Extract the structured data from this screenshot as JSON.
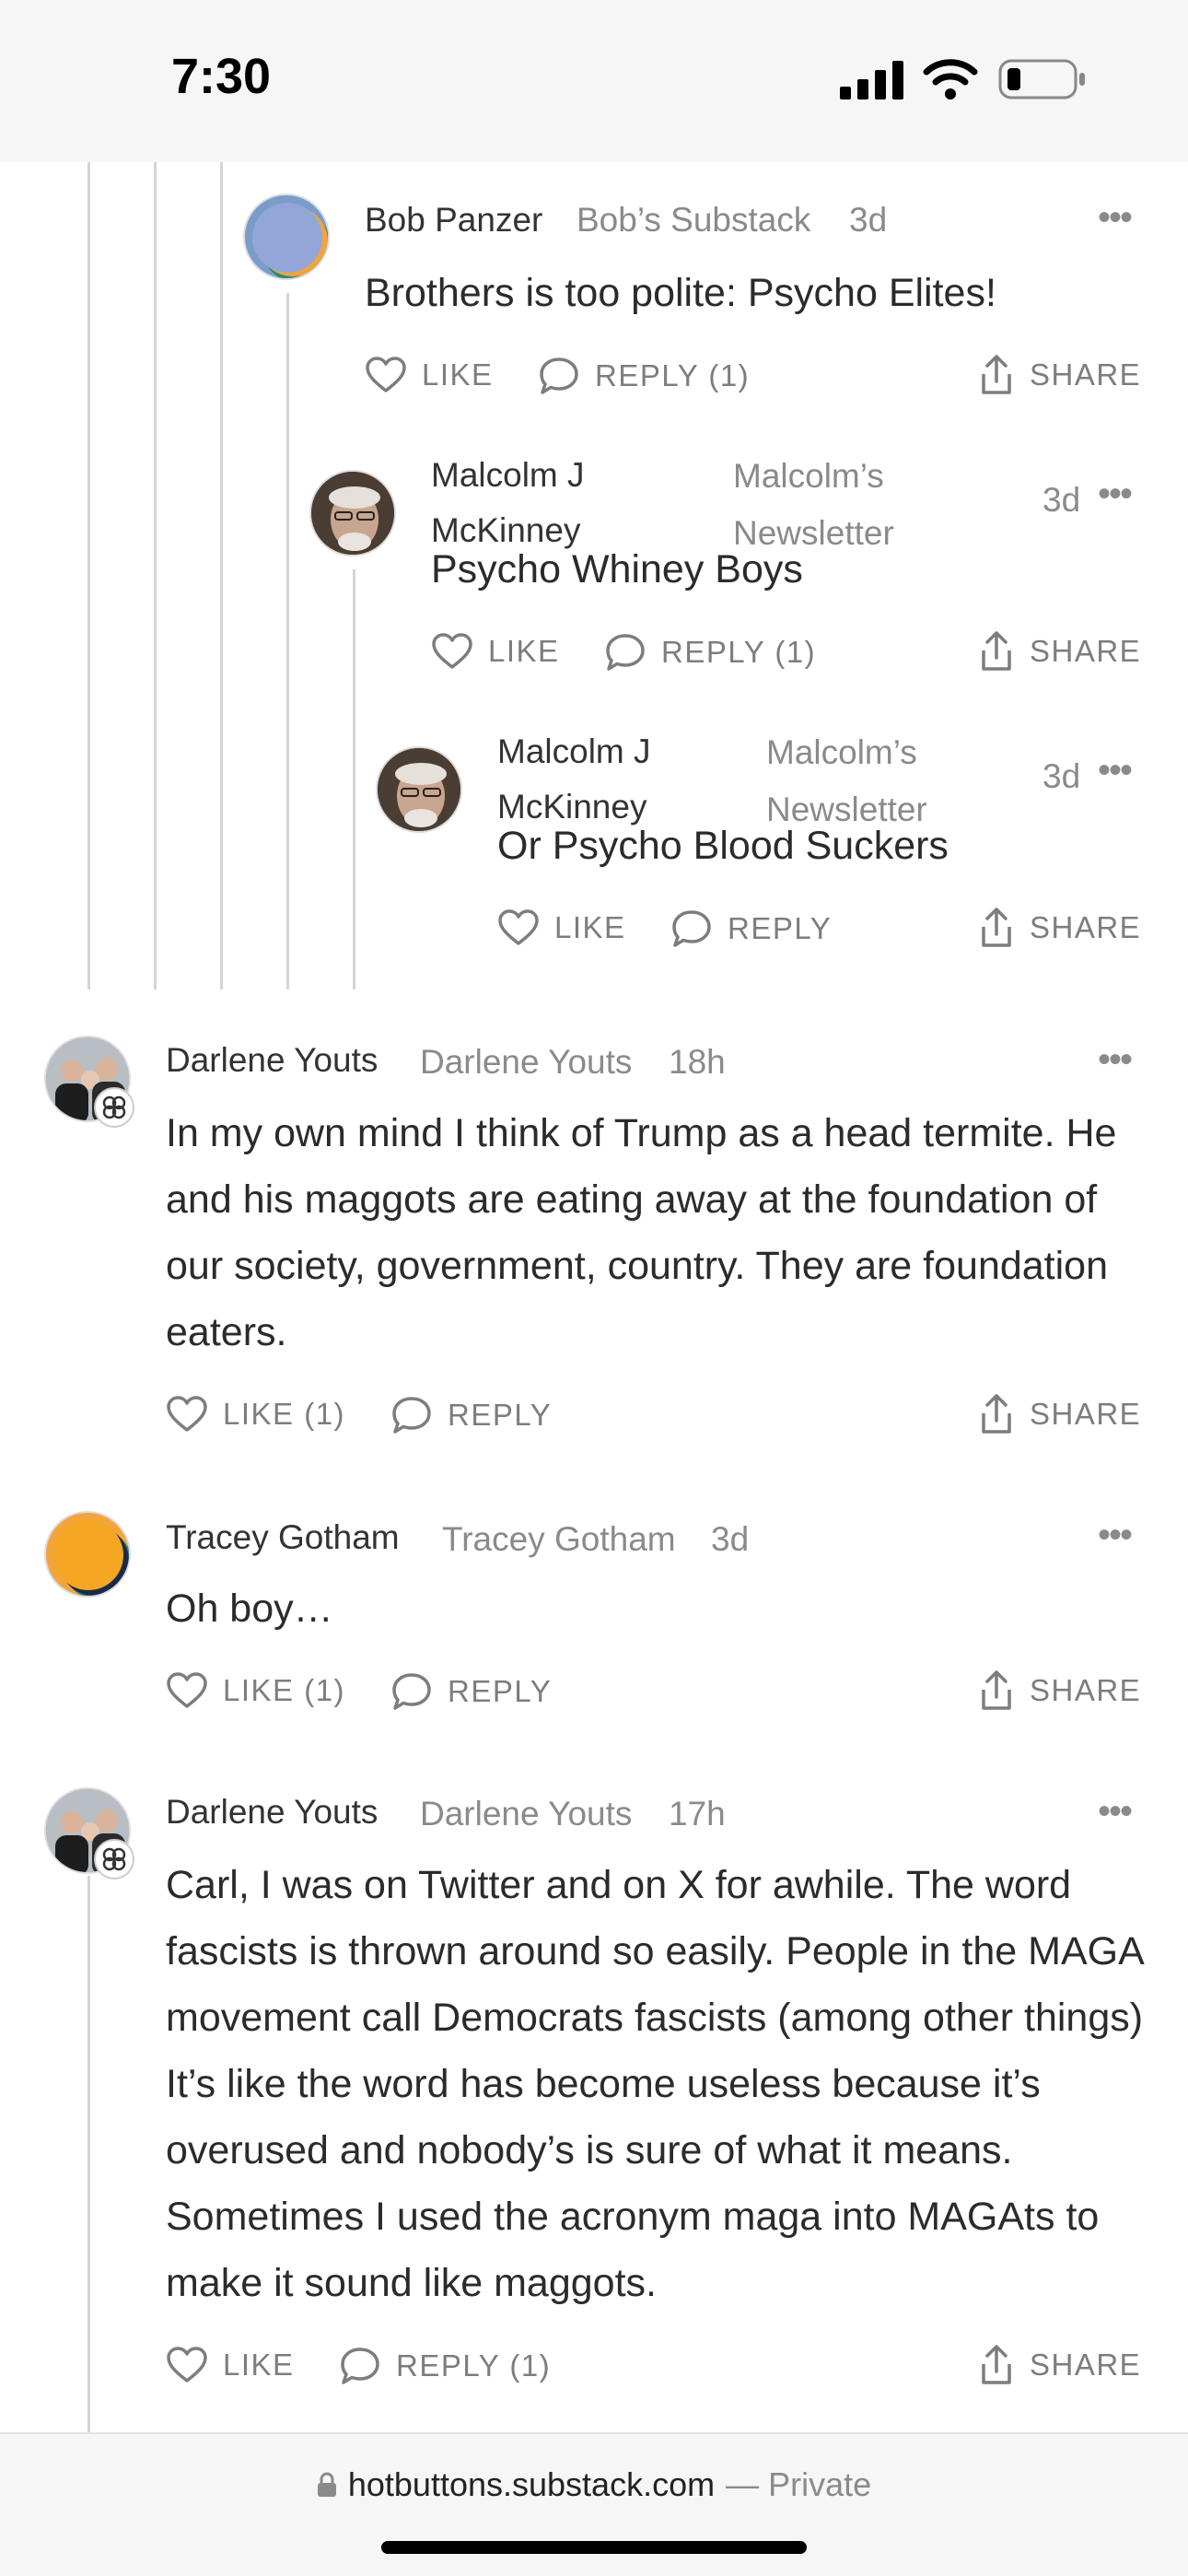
{
  "status_bar": {
    "time": "7:30"
  },
  "comments": [
    {
      "name": "Bob Panzer",
      "publication": "Bob’s Substack",
      "time": "3d",
      "text": "Brothers is too polite: Psycho Elites!",
      "like": "LIKE",
      "reply": "REPLY (1)",
      "share": "SHARE"
    },
    {
      "name_line1": "Malcolm J",
      "name_line2": "McKinney",
      "pub_line1": "Malcolm’s",
      "pub_line2": "Newsletter",
      "time": "3d",
      "text": "Psycho Whiney Boys",
      "like": "LIKE",
      "reply": "REPLY (1)",
      "share": "SHARE"
    },
    {
      "name_line1": "Malcolm J",
      "name_line2": "McKinney",
      "pub_line1": "Malcolm’s",
      "pub_line2": "Newsletter",
      "time": "3d",
      "text": "Or Psycho Blood Suckers",
      "like": "LIKE",
      "reply": "REPLY",
      "share": "SHARE"
    },
    {
      "name": "Darlene Youts",
      "publication": "Darlene Youts",
      "time": "18h",
      "text": "In my own mind I think of Trump as a head termite. He and his maggots are eating away at the foundation of our society, government, country. They are foundation eaters.",
      "like": "LIKE (1)",
      "reply": "REPLY",
      "share": "SHARE"
    },
    {
      "name": "Tracey Gotham",
      "publication": "Tracey Gotham",
      "time": "3d",
      "text": "Oh boy…",
      "like": "LIKE (1)",
      "reply": "REPLY",
      "share": "SHARE"
    },
    {
      "name": "Darlene Youts",
      "publication": "Darlene Youts",
      "time": "17h",
      "text": "Carl, I was on Twitter and on X for awhile. The word fascists is thrown around so easily. People in the MAGA movement call Democrats fascists (among other things) It’s like the word has become useless because it’s overused and nobody’s is sure of what it means. Sometimes I used the acronym maga into MAGAts to make it sound like maggots.",
      "like": "LIKE",
      "reply": "REPLY (1)",
      "share": "SHARE"
    }
  ],
  "browser_bar": {
    "url": "hotbuttons.substack.com",
    "separator": "—",
    "private": "Private"
  },
  "colors": {
    "text": "#2b2b2b",
    "meta": "#8a8a8a",
    "thread_line": "#d5d5d5",
    "bar_bg": "#f6f6f6"
  }
}
